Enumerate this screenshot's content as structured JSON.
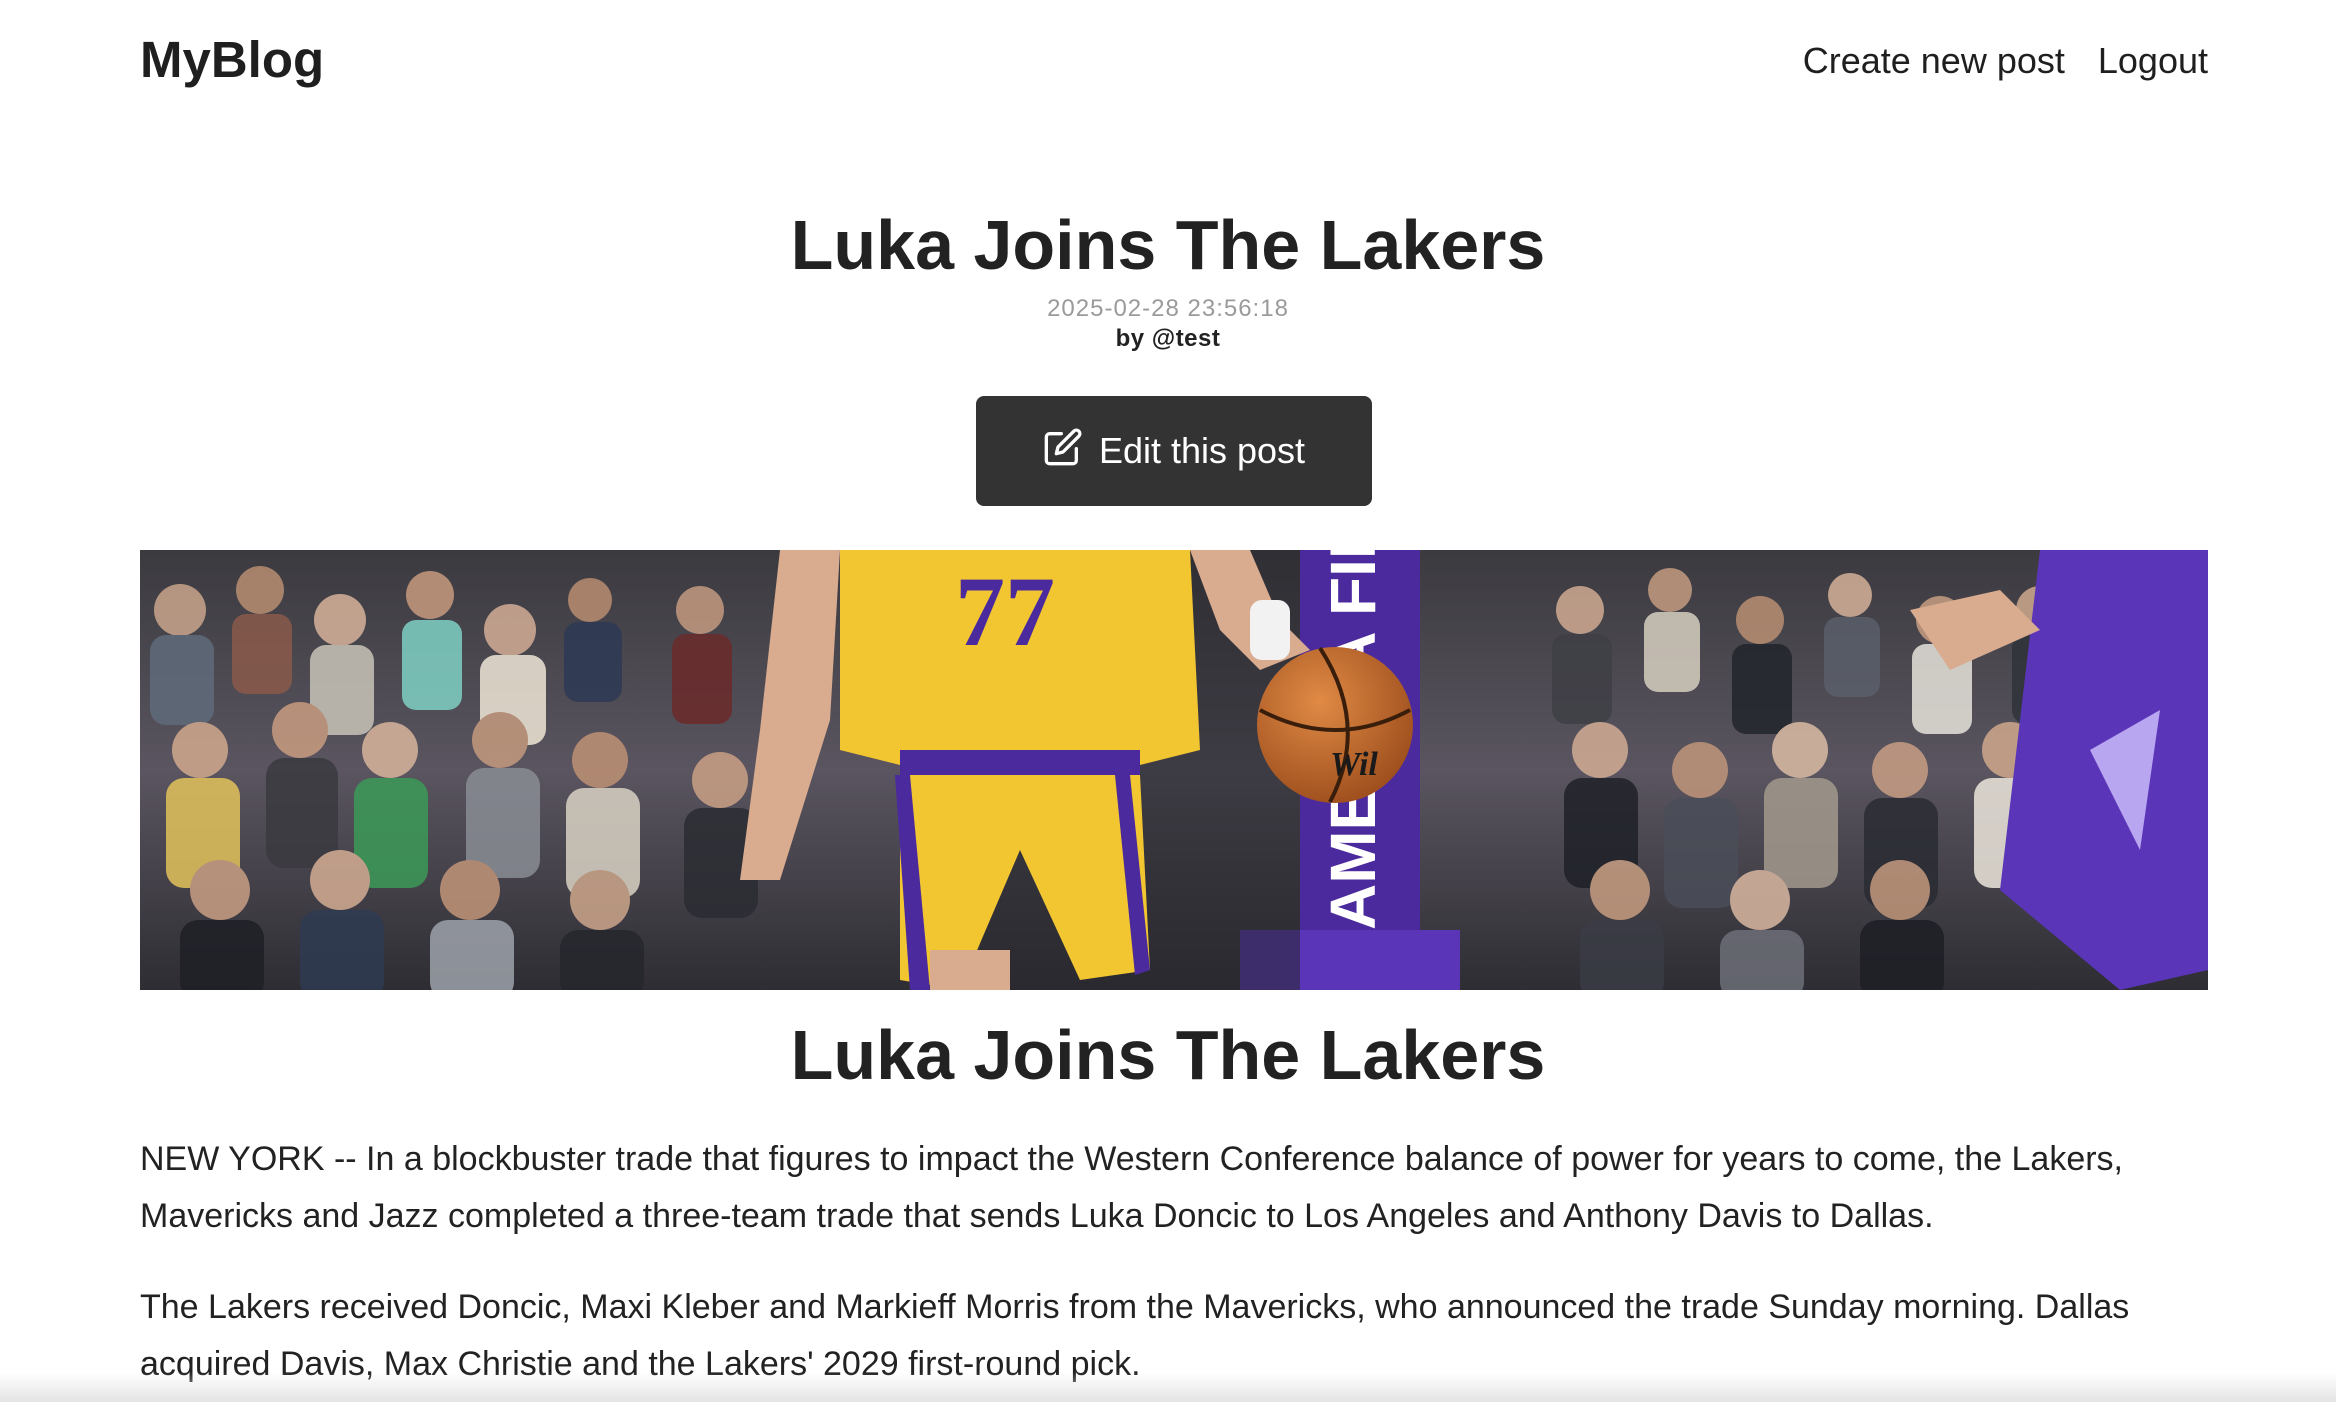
{
  "nav": {
    "brand": "MyBlog",
    "links": [
      {
        "label": "Create new post"
      },
      {
        "label": "Logout"
      }
    ]
  },
  "post": {
    "title": "Luka Joins The Lakers",
    "date": "2025-02-28 23:56:18",
    "author": "by @test",
    "edit_label": "Edit this post",
    "hero_image": {
      "jersey_number": "77",
      "banner_text": "AMERICA FIRS",
      "ball_text": "Wil",
      "colors": {
        "gold": "#f2c631",
        "purple": "#4b2a9e",
        "ball": "#c86a2c"
      }
    },
    "article_title": "Luka Joins The Lakers",
    "paragraphs": [
      "NEW YORK -- In a blockbuster trade that figures to impact the Western Conference balance of power for years to come, the Lakers, Mavericks and Jazz completed a three-team trade that sends Luka Doncic to Los Angeles and Anthony Davis to Dallas.",
      "The Lakers received Doncic, Maxi Kleber and Markieff Morris from the Mavericks, who announced the trade Sunday morning. Dallas acquired Davis, Max Christie and the Lakers' 2029 first-round pick."
    ]
  },
  "theme": {
    "button_bg": "#333333",
    "text": "#222222",
    "muted": "#9a9a9a"
  }
}
